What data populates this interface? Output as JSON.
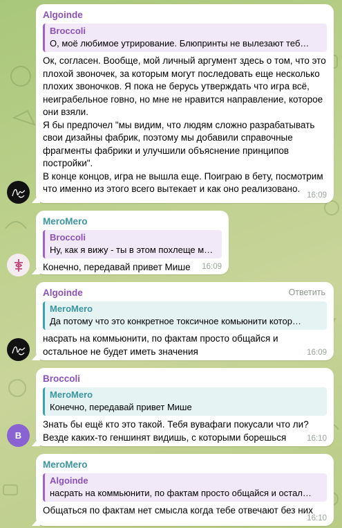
{
  "colors": {
    "purple_name": "#8b51b8",
    "teal_name": "#3a95a3",
    "avatar_b": "#8a63d2",
    "bubble": "#ffffff"
  },
  "messages": [
    {
      "sender": "Algoinde",
      "reply_name": "Broccoli",
      "reply_text": "О, моё любимое утрирование.  Блюпринты не вылезают теб…",
      "body": "Ок, согласен. Вообще, мой личный аргумент здесь о том, что это\nплохой звоночек, за которым могут последовать еще несколько\nплохих звоночков. Я пока не берусь утверждать что игра всё,\nнеиграбельное говно, но мне не нравится направление, которое\nони взяли.\nЯ бы предпочел \"мы видим, что людям сложно разрабатывать\nсвои дизайны фабрик, поэтому мы добавили справочные\nфрагменты фабрики и улучшили объяснение принципов\nпостройки\".\nВ конце концов, игра не вышла еще. Поиграю в бету, посмотрим\nчто именно из этого всего вытекает и как оно реализовано.",
      "time": "16:09",
      "avatar": "signature-avatar"
    },
    {
      "sender": "MeroMero",
      "reply_name": "Broccoli",
      "reply_text": "Ну, как я вижу - ты в этом похлеще м…",
      "body": "Конечно, передавай привет Мише",
      "time": "16:09",
      "avatar": "symbol-avatar"
    },
    {
      "sender": "Algoinde",
      "answer_label": "Ответить",
      "reply_name": "MeroMero",
      "reply_text": "Да потому что это конкретное токсичное комьюнити котор…",
      "body": "насрать на коммьюнити, по фактам просто общайся и\nостальное не будет иметь значения",
      "time": "16:09",
      "avatar": "signature-avatar"
    },
    {
      "sender": "Broccoli",
      "reply_name": "MeroMero",
      "reply_text": "Конечно, передавай привет Мише",
      "body": "Знать бы ещё кто это такой. Тебя вувафаги покусали что ли?\nВезде каких-то геншинят видишь, с которыми борешься",
      "time": "16:10",
      "avatar_letter": "B"
    },
    {
      "sender": "MeroMero",
      "reply_name": "Algoinde",
      "reply_text": "насрать на коммьюнити, по фактам просто общайся и остал…",
      "body": "Общаться по фактам нет смысла когда тебе отвечают без них",
      "time": "16:10"
    }
  ]
}
